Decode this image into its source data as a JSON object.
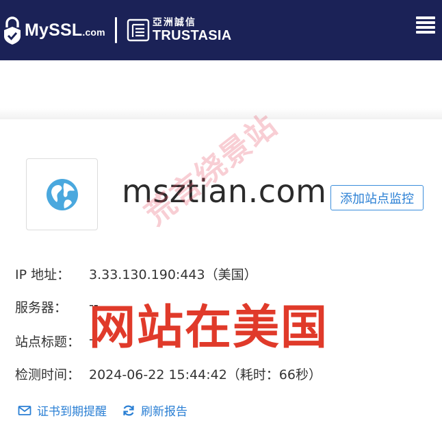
{
  "header": {
    "brand_name": "MySSL",
    "brand_tld": ".com",
    "partner_cn": "亞洲誠信",
    "partner_en": "TRUSTASIA",
    "menu_icon": "hamburger-icon",
    "bg_color": "#1b2257"
  },
  "site": {
    "domain": "msztian.com",
    "monitor_button": "添加站点监控",
    "icon": "globe-icon"
  },
  "details": [
    {
      "label": "IP 地址：",
      "value": "3.33.130.190:443（美国）"
    },
    {
      "label": "服务器：",
      "value": "--"
    },
    {
      "label": "站点标题：",
      "value": "--"
    },
    {
      "label": "检测时间：",
      "value": "2024-06-22 15:44:42（耗时：66秒）"
    }
  ],
  "actions": {
    "expiry_reminder": "证书到期提醒",
    "refresh_report": "刷新报告"
  },
  "overlay": {
    "caption": "网站在美国",
    "watermark": "荒言绕景站",
    "caption_color": "#e03a2a"
  }
}
